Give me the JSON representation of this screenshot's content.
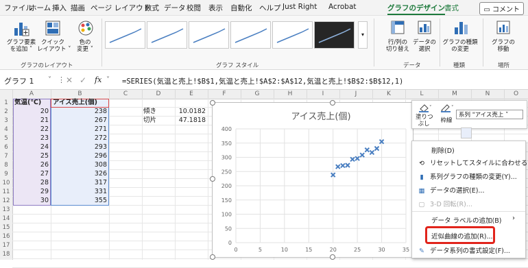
{
  "menu": {
    "items": [
      "ファイル",
      "ホーム",
      "挿入",
      "描画",
      "ページ レイアウト",
      "数式",
      "データ",
      "校閲",
      "表示",
      "自動化",
      "ヘルプ",
      "Just Right",
      "Acrobat",
      "グラフのデザイン",
      "書式"
    ],
    "comment": "コメント"
  },
  "ribbon": {
    "add_element": "グラフ要素\nを追加 ˅",
    "quick_layout": "クイック\nレイアウト ˅",
    "change_color": "色の\n変更 ˅",
    "group_layout": "グラフのレイアウト",
    "group_style": "グラフ スタイル",
    "switch_rowcol": "行/列の\n切り替え",
    "select_data": "データの\n選択",
    "group_data": "データ",
    "change_type": "グラフの種類\nの変更",
    "group_type": "種類",
    "move_chart": "グラフの\n移動",
    "group_location": "場所"
  },
  "formula_bar": {
    "name_box": "グラフ 1",
    "fx": "fx",
    "formula": "=SERIES(気温と売上!$B$1,気温と売上!$A$2:$A$12,気温と売上!$B$2:$B$12,1)"
  },
  "columns": [
    "A",
    "B",
    "C",
    "D",
    "E",
    "F",
    "G",
    "H",
    "I",
    "J",
    "K",
    "L",
    "M",
    "N",
    "O"
  ],
  "rows": [
    "1",
    "2",
    "3",
    "4",
    "5",
    "6",
    "7",
    "8",
    "9",
    "10",
    "11",
    "12",
    "13",
    "14",
    "15",
    "16",
    "17",
    "18"
  ],
  "table": {
    "headers": [
      "気温(℃)",
      "アイス売上(個)"
    ],
    "temps": [
      "20",
      "21",
      "22",
      "23",
      "24",
      "25",
      "26",
      "27",
      "28",
      "29",
      "30"
    ],
    "sales": [
      "238",
      "267",
      "271",
      "272",
      "293",
      "296",
      "308",
      "326",
      "317",
      "331",
      "355"
    ]
  },
  "stats": {
    "slope_label": "傾き",
    "slope_value": "10.0182",
    "intercept_label": "切片",
    "intercept_value": "47.1818"
  },
  "chart_data": {
    "type": "scatter",
    "title": "アイス売上(個)",
    "xlim": [
      0,
      35
    ],
    "ylim": [
      0,
      400
    ],
    "x_ticks": [
      "0",
      "5",
      "10",
      "15",
      "20",
      "25",
      "30",
      "35"
    ],
    "y_ticks": [
      "0",
      "50",
      "100",
      "150",
      "200",
      "250",
      "300",
      "350",
      "400"
    ],
    "x": [
      20,
      21,
      22,
      23,
      24,
      25,
      26,
      27,
      28,
      29,
      30
    ],
    "y": [
      238,
      267,
      271,
      272,
      293,
      296,
      308,
      326,
      317,
      331,
      355
    ],
    "marker_color": "#4a7fc1",
    "grid": true
  },
  "mini_toolbar": {
    "fill": "塗りつ\nぶし",
    "outline": "枠線",
    "series_select": "系列 \"アイス売上 ˅"
  },
  "context_menu": {
    "items": [
      {
        "label": "削除(D)",
        "disabled": false
      },
      {
        "label": "リセットしてスタイルに合わせる(A)",
        "disabled": false
      },
      {
        "label": "系列グラフの種類の変更(Y)...",
        "disabled": false
      },
      {
        "label": "データの選択(E)...",
        "disabled": false
      },
      {
        "label": "3-D 回転(R)...",
        "disabled": true
      },
      {
        "label": "データ ラベルの追加(B)",
        "disabled": false
      },
      {
        "label": "近似曲線の追加(R)...",
        "disabled": false
      },
      {
        "label": "データ系列の書式設定(F)...",
        "disabled": false
      }
    ]
  }
}
